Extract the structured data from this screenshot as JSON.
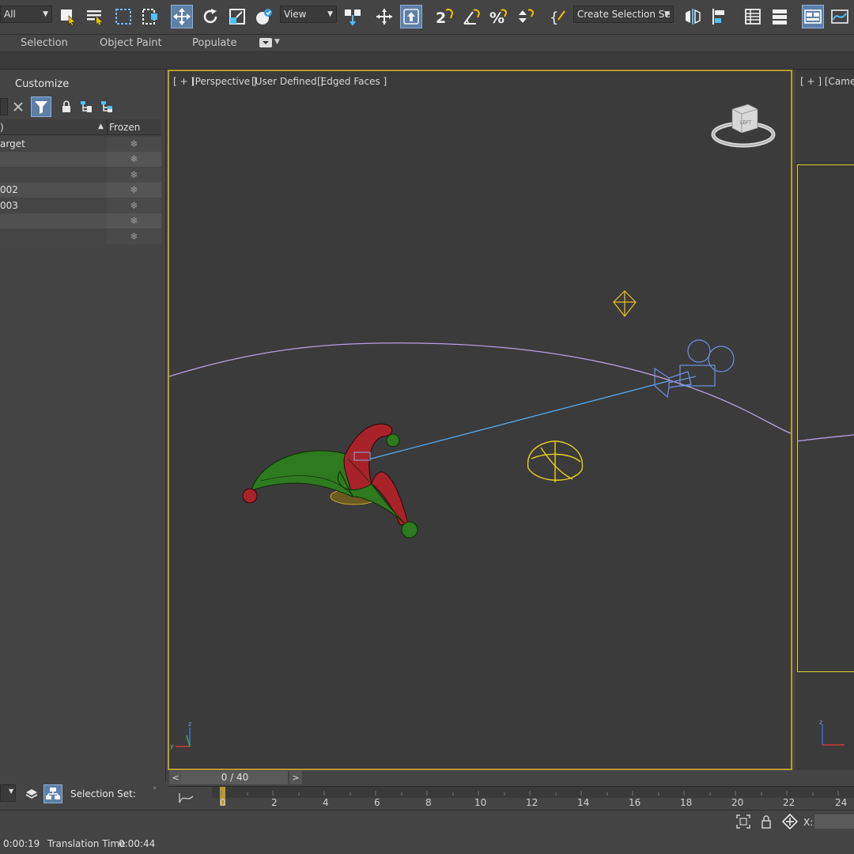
{
  "toolbar": {
    "filter_dropdown": "All",
    "view_dropdown": "View",
    "selection_set_dropdown": "Create Selection Se"
  },
  "ribbon": {
    "tabs": [
      "Selection",
      "Object Paint",
      "Populate"
    ]
  },
  "scene_explorer": {
    "menu_label": "Customize",
    "column_name": ")",
    "column_frozen": "Frozen",
    "rows": [
      {
        "name": "arget"
      },
      {
        "name": ""
      },
      {
        "name": ""
      },
      {
        "name": "002"
      },
      {
        "name": "003"
      },
      {
        "name": ""
      },
      {
        "name": ""
      }
    ],
    "selection_set_label": "Selection Set:"
  },
  "viewport_main": {
    "label_plus": "[ + ]",
    "label_view": "[Perspective ]",
    "label_user": "[User Defined ]",
    "label_shading": "[Edged Faces ]",
    "viewcube_face": "LEFT"
  },
  "viewport_right": {
    "label": "[ + ] [Camera"
  },
  "timeline": {
    "slider_text": "0 / 40",
    "ticks": [
      "0",
      "2",
      "4",
      "6",
      "8",
      "10",
      "12",
      "14",
      "16",
      "18",
      "20",
      "22",
      "24"
    ]
  },
  "status": {
    "time_left": "0:00:19",
    "translation_label": "Translation Time",
    "translation_value": "0:00:44",
    "x_label": "X:"
  },
  "colors": {
    "viewport_border": "#b89b32",
    "active_button": "#5d7fa8",
    "hat_red": "#a8222a",
    "hat_green": "#2e7a1e",
    "camera_blue": "#7090e0",
    "light_yellow": "#e8d020",
    "path_lilac": "#b9a0e0"
  }
}
